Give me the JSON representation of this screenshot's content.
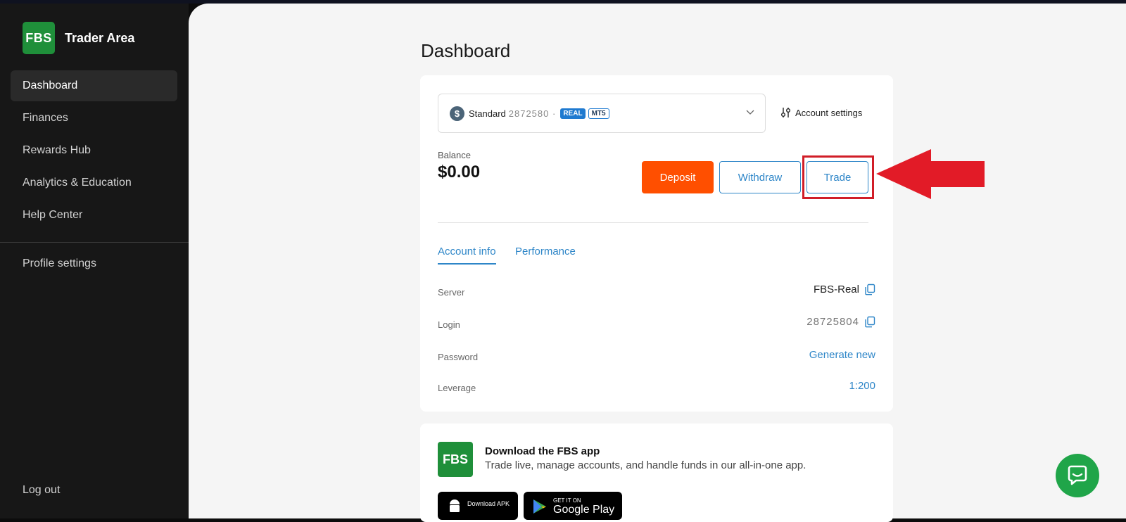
{
  "sidebar": {
    "brand": "Trader Area",
    "logo_text": "FBS",
    "items": [
      {
        "label": "Dashboard",
        "active": true
      },
      {
        "label": "Finances"
      },
      {
        "label": "Rewards Hub"
      },
      {
        "label": "Analytics & Education"
      },
      {
        "label": "Help Center"
      }
    ],
    "profile": "Profile settings",
    "logout": "Log out"
  },
  "page": {
    "title": "Dashboard"
  },
  "account": {
    "type": "Standard",
    "number_masked": "2872580 ·",
    "badge_real": "REAL",
    "badge_platform": "MT5",
    "settings_label": "Account settings",
    "balance_label": "Balance",
    "balance_value": "$0.00"
  },
  "actions": {
    "deposit": "Deposit",
    "withdraw": "Withdraw",
    "trade": "Trade"
  },
  "tabs": {
    "info": "Account info",
    "performance": "Performance"
  },
  "info_rows": {
    "server_label": "Server",
    "server_value": "FBS-Real",
    "login_label": "Login",
    "login_value": "28725804",
    "password_label": "Password",
    "password_action": "Generate new",
    "leverage_label": "Leverage",
    "leverage_value": "1:200"
  },
  "app_promo": {
    "logo_text": "FBS",
    "title": "Download the FBS app",
    "subtitle": "Trade live, manage accounts, and handle funds in our all-in-one app.",
    "apk_label": "Download APK",
    "gp_small": "GET IT ON",
    "gp_big": "Google Play"
  },
  "colors": {
    "accent": "#2e86c8",
    "deposit": "#ff4f00",
    "brand": "#1f8f3a",
    "highlight": "#d11d27"
  }
}
